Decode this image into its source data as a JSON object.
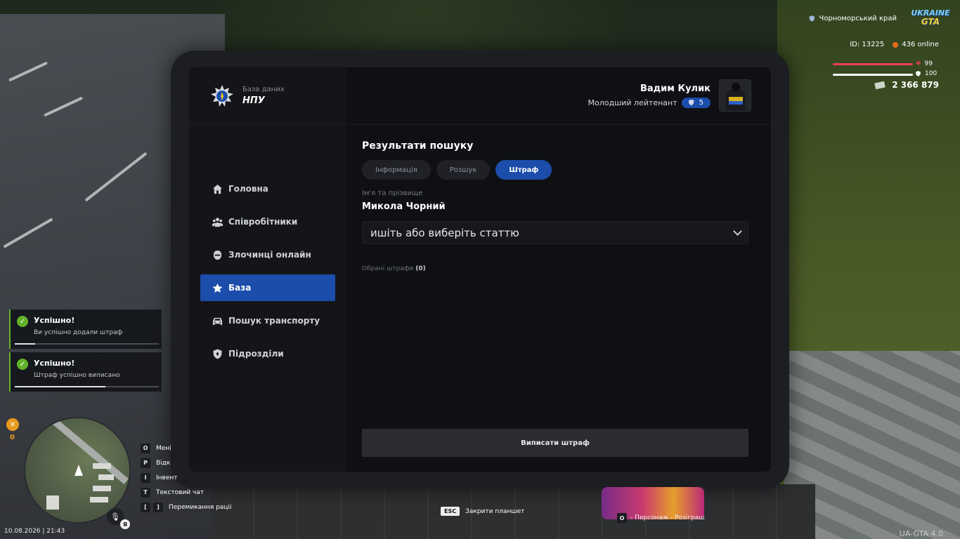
{
  "tablet": {
    "brand": {
      "subtitle": "База даних",
      "title": "НПУ"
    },
    "nav": [
      {
        "label": "Головна",
        "icon": "home-icon"
      },
      {
        "label": "Співробітники",
        "icon": "staff-icon"
      },
      {
        "label": "Злочинці онлайн",
        "icon": "criminal-icon"
      },
      {
        "label": "База",
        "icon": "star-icon",
        "active": true
      },
      {
        "label": "Пошук транспорту",
        "icon": "car-icon"
      },
      {
        "label": "Підрозділи",
        "icon": "shield-icon"
      }
    ],
    "user": {
      "name": "Вадим Кулик",
      "rank": "Молодший лейтенант",
      "level": "5"
    },
    "results": {
      "title": "Результати пошуку",
      "tabs": [
        "Інформація",
        "Розшук",
        "Штраф"
      ],
      "active_tab": "Штраф",
      "name_label": "Ім'я та прізвище",
      "name_value": "Микола Чорний",
      "select_placeholder": "ишіть або виберіть статтю",
      "chosen_label": "Обрані штрафи",
      "chosen_count": "(0)",
      "submit_label": "Виписати штраф"
    }
  },
  "hud": {
    "region": "Чорноморський край",
    "logo_top": "UKRAINE",
    "logo_bottom": "GTA",
    "player_id": "ID: 13225",
    "online": "436 online",
    "health": "99",
    "armor": "100",
    "money": "2 366 879",
    "health_color": "#e8404d",
    "armor_color": "#ffffff"
  },
  "notifications": [
    {
      "title": "Успішно!",
      "text": "Ви успішно додали штраф",
      "progress": 0.14
    },
    {
      "title": "Успішно!",
      "text": "Штраф успішно виписано",
      "progress": 0.63
    }
  ],
  "minimap": {
    "side_count": "0",
    "layout_letter": "Я"
  },
  "keys": [
    {
      "keys": [
        "O"
      ],
      "label": "Мені"
    },
    {
      "keys": [
        "P"
      ],
      "label": "Відк"
    },
    {
      "keys": [
        "I"
      ],
      "label": "Інвент"
    },
    {
      "keys": [
        "T"
      ],
      "label": "Текстовий чат"
    },
    {
      "keys": [
        "[",
        "]"
      ],
      "label": "Перемикання раціі"
    }
  ],
  "datetime": "10.08.2026 | 21:43",
  "esc": {
    "key": "ESC",
    "label": "Закрити планшет"
  },
  "promo": {
    "key": "O",
    "label": "- Персонаж - Розіграш"
  },
  "version": "UA-GTA 4.0"
}
